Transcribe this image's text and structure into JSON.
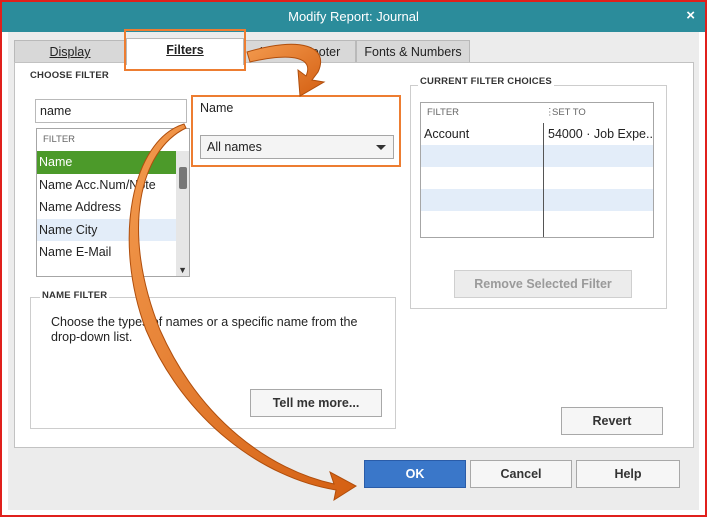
{
  "window": {
    "title": "Modify Report: Journal",
    "close_glyph": "×"
  },
  "tabs": [
    {
      "label": "Display"
    },
    {
      "label": "Filters"
    },
    {
      "label": "Header/Footer"
    },
    {
      "label": "Fonts & Numbers"
    }
  ],
  "choose_filter": {
    "heading": "CHOOSE FILTER",
    "search_value": "name",
    "list_header": "FILTER",
    "items": [
      "Name",
      "Name Acc.Num/Note",
      "Name Address",
      "Name City",
      "Name E-Mail"
    ]
  },
  "name_field": {
    "label": "Name",
    "selected": "All names"
  },
  "name_filter": {
    "heading": "NAME FILTER",
    "description": "Choose the types of names or a specific name from the drop-down list.",
    "tell_more_label": "Tell me more..."
  },
  "current_filters": {
    "heading": "CURRENT FILTER CHOICES",
    "col_filter": "FILTER",
    "col_set_to": "SET TO",
    "rows": [
      {
        "filter": "Account",
        "set_to": "54000 · Job Expe..."
      }
    ],
    "remove_label": "Remove Selected Filter"
  },
  "buttons": {
    "revert": "Revert",
    "ok": "OK",
    "cancel": "Cancel",
    "help": "Help"
  },
  "colors": {
    "highlight": "#ed7d31",
    "frame": "#e0201c",
    "titlebar": "#2b8c9b",
    "selection": "#4c9a2a",
    "primary": "#3a77c9"
  }
}
